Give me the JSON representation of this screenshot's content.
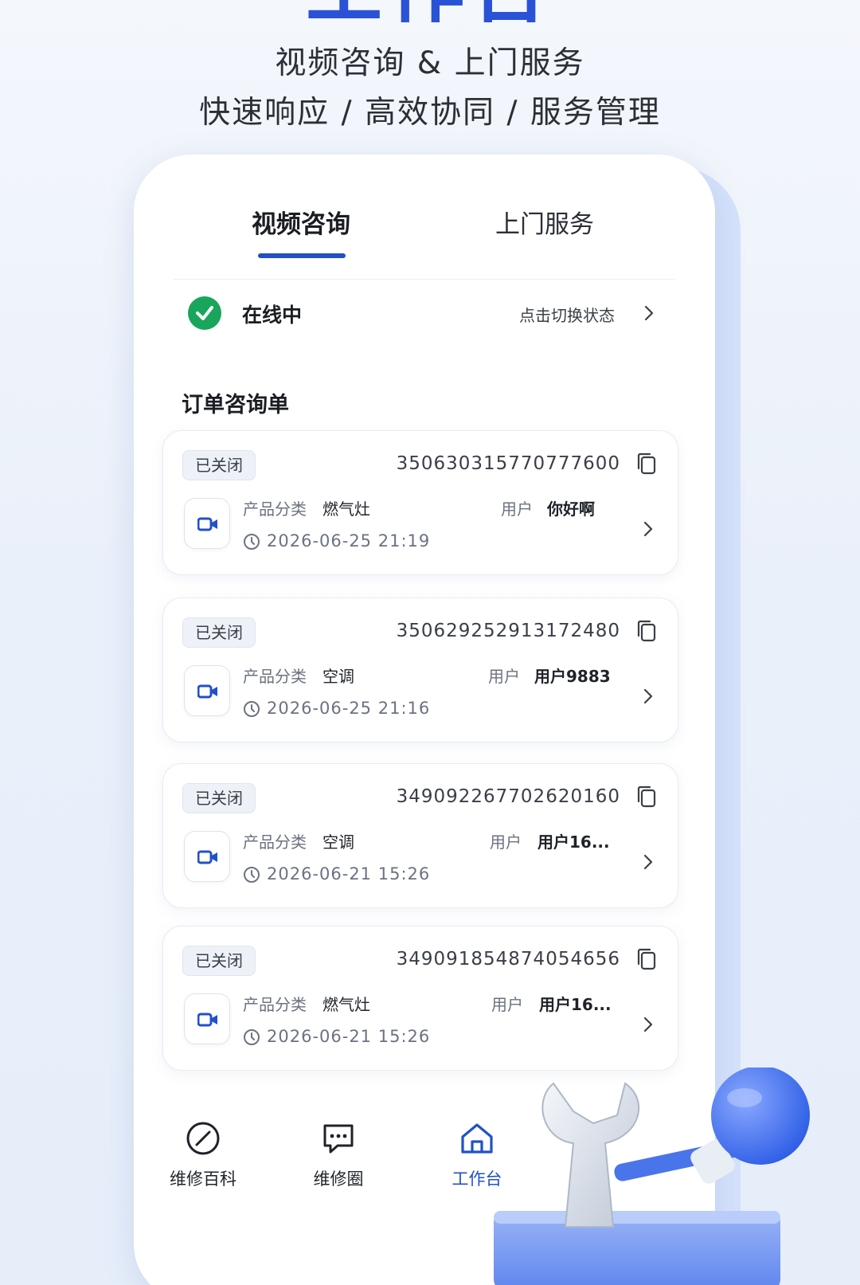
{
  "hero": {
    "title": "工作台",
    "subtitle_line1": "视频咨询 & 上门服务",
    "subtitle_line2": "快速响应 / 高效协同 / 服务管理"
  },
  "tabs": [
    {
      "label": "视频咨询",
      "active": true
    },
    {
      "label": "上门服务",
      "active": false
    }
  ],
  "status": {
    "label": "在线中",
    "switch_label": "点击切换状态"
  },
  "section_title": "订单咨询单",
  "orders": [
    {
      "status": "已关闭",
      "order_no": "350630315770777600",
      "category_label": "产品分类",
      "category": "燃气灶",
      "user_label": "用户",
      "user": "你好啊",
      "time": "2026-06-25 21:19"
    },
    {
      "status": "已关闭",
      "order_no": "350629252913172480",
      "category_label": "产品分类",
      "category": "空调",
      "user_label": "用户",
      "user": "用户9883",
      "time": "2026-06-25 21:16"
    },
    {
      "status": "已关闭",
      "order_no": "349092267702620160",
      "category_label": "产品分类",
      "category": "空调",
      "user_label": "用户",
      "user": "用户16...",
      "time": "2026-06-21 15:26"
    },
    {
      "status": "已关闭",
      "order_no": "349091854874054656",
      "category_label": "产品分类",
      "category": "燃气灶",
      "user_label": "用户",
      "user": "用户16...",
      "time": "2026-06-21 15:26"
    }
  ],
  "bottom_nav": [
    {
      "label": "维修百科",
      "icon": "compass-icon",
      "active": false
    },
    {
      "label": "维修圈",
      "icon": "chat-bubble-icon",
      "active": false
    },
    {
      "label": "工作台",
      "icon": "home-icon",
      "active": true
    }
  ],
  "colors": {
    "accent": "#2250c8",
    "online": "#1aa55c",
    "title": "#2a52d6"
  }
}
